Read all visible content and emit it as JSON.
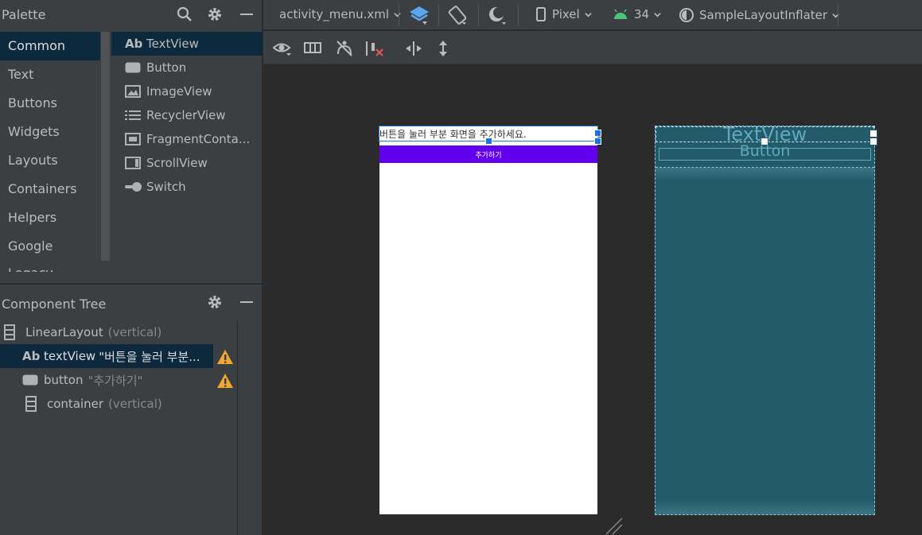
{
  "palette": {
    "title": "Palette",
    "categories": [
      "Common",
      "Text",
      "Buttons",
      "Widgets",
      "Layouts",
      "Containers",
      "Helpers",
      "Google",
      "Legacy"
    ],
    "selected_category": "Common",
    "widgets": [
      {
        "label": "TextView",
        "icon": "textview-icon",
        "prefix": "Ab"
      },
      {
        "label": "Button",
        "icon": "button-icon"
      },
      {
        "label": "ImageView",
        "icon": "image-icon"
      },
      {
        "label": "RecyclerView",
        "icon": "list-icon"
      },
      {
        "label": "FragmentConta...",
        "icon": "fragment-icon"
      },
      {
        "label": "ScrollView",
        "icon": "scroll-icon"
      },
      {
        "label": "Switch",
        "icon": "switch-icon"
      }
    ]
  },
  "component_tree": {
    "title": "Component Tree",
    "items": [
      {
        "name": "LinearLayout",
        "detail": "(vertical)",
        "icon": "linear-layout-icon"
      },
      {
        "prefix": "Ab",
        "name": "textView",
        "detail": "\"버튼을 눌러 부분...",
        "icon": "textview-icon",
        "warning": true
      },
      {
        "name": "button",
        "detail": "\"추가하기\"",
        "icon": "button-icon",
        "warning": true
      },
      {
        "name": "container",
        "detail": "(vertical)",
        "icon": "linear-layout-icon"
      }
    ]
  },
  "toolbar": {
    "file": "activity_menu.xml",
    "device": "Pixel",
    "api": "34",
    "theme": "SampleLayoutInflater"
  },
  "design": {
    "textview_text": "버튼을 눌러 부분 화면을 추가하세요.",
    "button_text": "추가하기"
  },
  "blueprint": {
    "textview_text": "TextView",
    "button_text": "Button"
  },
  "colors": {
    "accent": "#6200ee",
    "selection": "#1a73e8",
    "blueprint_bg": "#235b6b",
    "warning": "#f0a732"
  }
}
